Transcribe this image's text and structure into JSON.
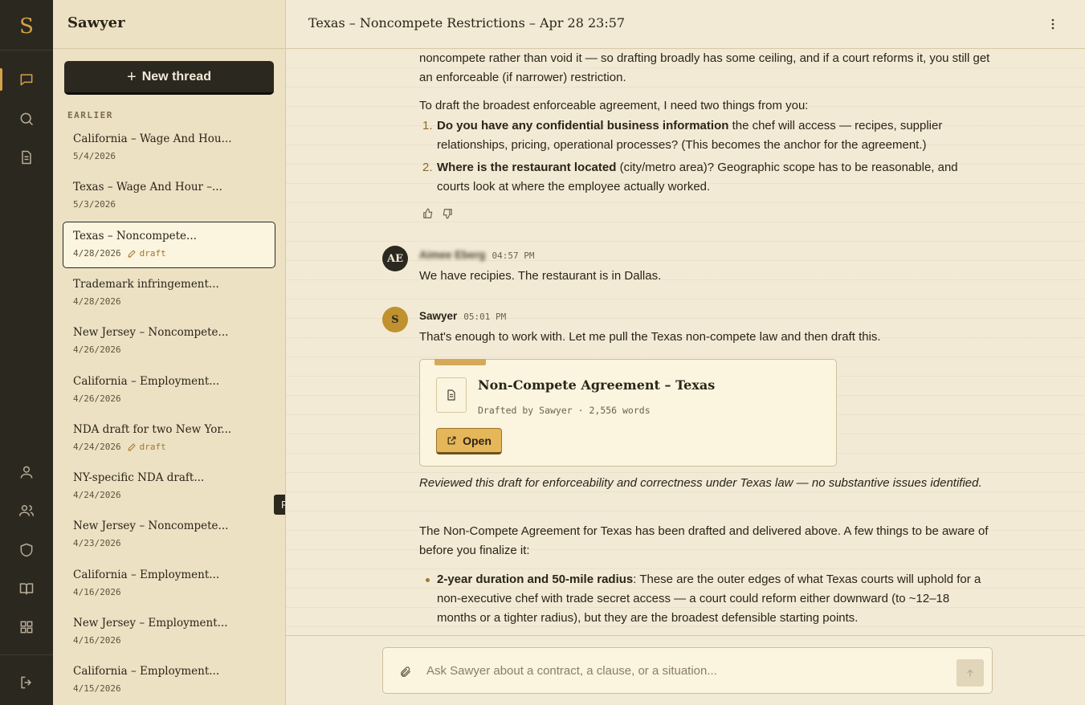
{
  "rail": {
    "logo": "S",
    "items": [
      {
        "icon": "chat-icon",
        "active": true
      },
      {
        "icon": "search-icon"
      },
      {
        "icon": "document-icon"
      },
      {
        "icon": "user-icon"
      },
      {
        "icon": "users-icon"
      },
      {
        "icon": "shield-icon"
      },
      {
        "icon": "book-icon"
      },
      {
        "icon": "grid-icon"
      },
      {
        "icon": "logout-icon"
      }
    ]
  },
  "sidebar": {
    "brand": "Sawyer",
    "new_thread_label": "New thread",
    "section_label": "EARLIER",
    "tooltip": "Pin",
    "threads": [
      {
        "title": "California – Wage And Hou...",
        "date": "5/4/2026"
      },
      {
        "title": "Texas – Wage And Hour –...",
        "date": "5/3/2026"
      },
      {
        "title": "Texas – Noncompete...",
        "date": "4/28/2026",
        "draft": "draft",
        "selected": true
      },
      {
        "title": "Trademark infringement...",
        "date": "4/28/2026"
      },
      {
        "title": "New Jersey – Noncompete...",
        "date": "4/26/2026"
      },
      {
        "title": "California – Employment...",
        "date": "4/26/2026"
      },
      {
        "title": "NDA draft for two New Yor...",
        "date": "4/24/2026",
        "draft": "draft"
      },
      {
        "title": "NY-specific NDA draft...",
        "date": "4/24/2026"
      },
      {
        "title": "New Jersey – Noncompete...",
        "date": "4/23/2026"
      },
      {
        "title": "California – Employment...",
        "date": "4/16/2026"
      },
      {
        "title": "New Jersey – Employment...",
        "date": "4/16/2026"
      },
      {
        "title": "California – Employment...",
        "date": "4/15/2026"
      }
    ]
  },
  "header": {
    "title": "Texas – Noncompete Restrictions – Apr 28 23:57"
  },
  "chat": {
    "p1": "noncompete rather than void it — so drafting broadly has some ceiling, and if a court reforms it, you still get an enforceable (if narrower) restriction.",
    "p2": "To draft the broadest enforceable agreement, I need two things from you:",
    "q1_bold": "Do you have any confidential business information",
    "q1_rest": " the chef will access — recipes, supplier relationships, pricing, operational processes? (This becomes the anchor for the agreement.)",
    "q2_bold": "Where is the restaurant located",
    "q2_rest": " (city/metro area)? Geographic scope has to be reasonable, and courts look at where the employee actually worked.",
    "user_avatar": "AE",
    "user_name": "Aimee Eberg",
    "user_time": "04:57 PM",
    "user_msg": "We have recipies. The restaurant is in Dallas.",
    "bot_avatar": "S",
    "bot_name": "Sawyer",
    "bot_time": "05:01 PM",
    "bot_msg": "That's enough to work with. Let me pull the Texas non-compete law and then draft this.",
    "doc": {
      "title": "Non-Compete Agreement – Texas",
      "meta": "Drafted by Sawyer · 2,556 words",
      "open_label": "Open"
    },
    "review": "Reviewed this draft for enforceability and correctness under Texas law — no substantive issues identified.",
    "summary": "The Non-Compete Agreement for Texas has been drafted and delivered above. A few things to be aware of before you finalize it:",
    "b1_bold": "2-year duration and 50-mile radius",
    "b1_rest": ": These are the outer edges of what Texas courts will uphold for a non-executive chef with trade secret access — a court could reform either downward (to ~12–18 months or a tighter radius), but they are the broadest defensible starting points."
  },
  "composer": {
    "placeholder": "Ask Sawyer about a contract, a clause, or a situation..."
  },
  "colors": {
    "rail_bg": "#2b2820",
    "sidebar_bg": "#ede1c4",
    "main_bg": "#f3ead6",
    "accent": "#d4a24a"
  }
}
